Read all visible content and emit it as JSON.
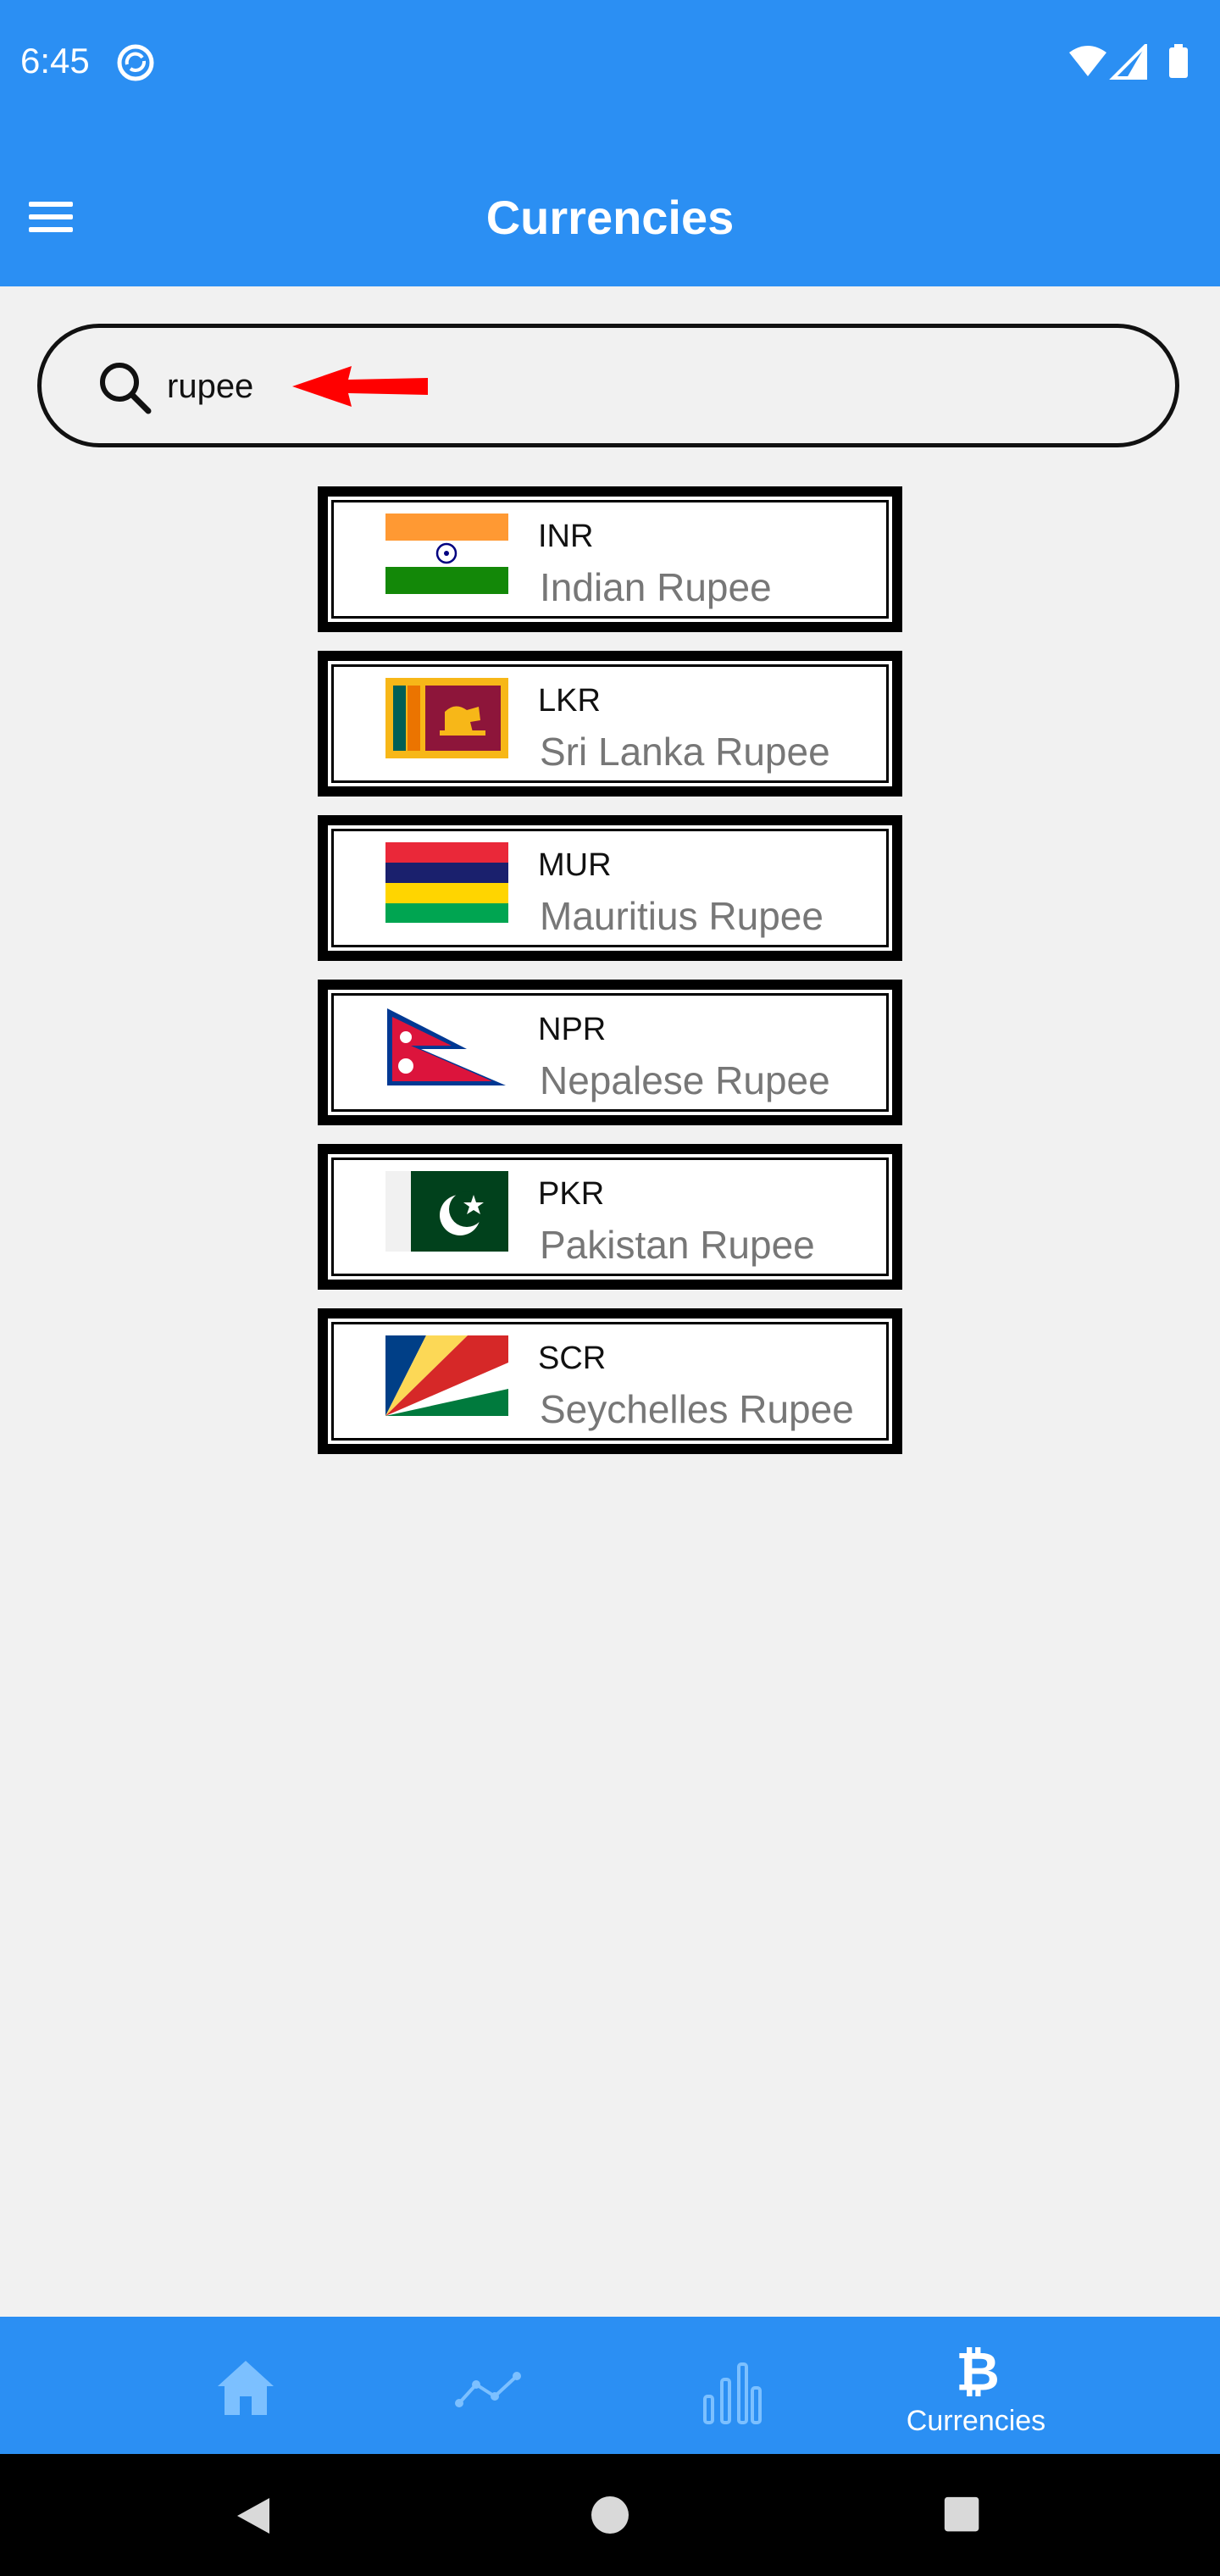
{
  "status_bar": {
    "time": "6:45"
  },
  "app_bar": {
    "title": "Currencies"
  },
  "search": {
    "value": "rupee"
  },
  "currencies": [
    {
      "code": "INR",
      "name": "Indian Rupee",
      "flag": "india-flag"
    },
    {
      "code": "LKR",
      "name": "Sri Lanka Rupee",
      "flag": "sri-lanka-flag"
    },
    {
      "code": "MUR",
      "name": "Mauritius Rupee",
      "flag": "mauritius-flag"
    },
    {
      "code": "NPR",
      "name": "Nepalese Rupee",
      "flag": "nepal-flag"
    },
    {
      "code": "PKR",
      "name": "Pakistan Rupee",
      "flag": "pakistan-flag"
    },
    {
      "code": "SCR",
      "name": "Seychelles Rupee",
      "flag": "seychelles-flag"
    }
  ],
  "bottom_nav": {
    "items": [
      {
        "icon": "home-icon",
        "label": ""
      },
      {
        "icon": "trend-line-icon",
        "label": ""
      },
      {
        "icon": "bar-chart-icon",
        "label": ""
      },
      {
        "icon": "bitcoin-icon",
        "label": "Currencies",
        "active": true
      }
    ]
  },
  "colors": {
    "primary": "#2b8ff3",
    "inactive_icon": "#7cc0ff",
    "annotation": "#ff0000"
  }
}
